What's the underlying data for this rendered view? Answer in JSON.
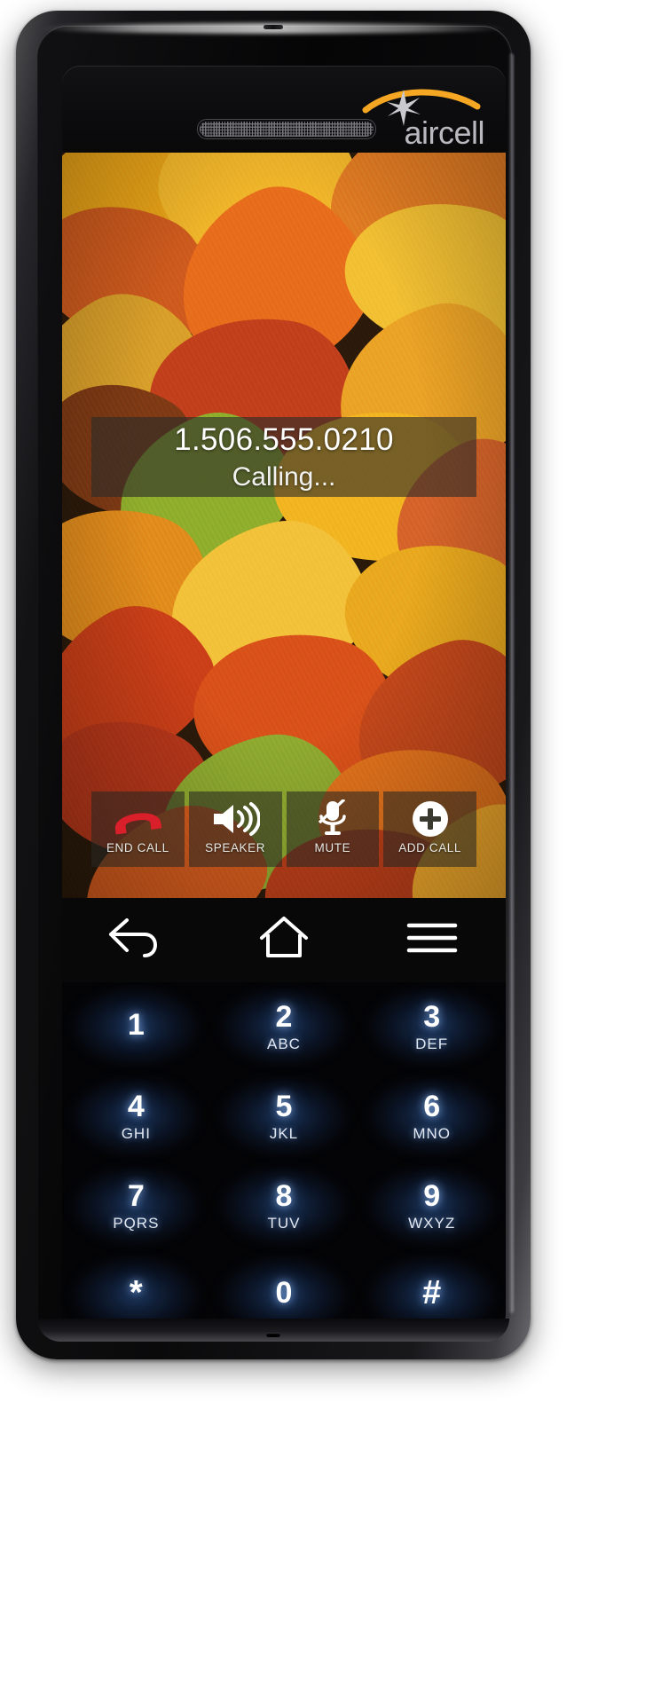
{
  "device": {
    "brand_name": "aircell",
    "brand_logo_icon": "aircell-swoosh-star-logo",
    "earpiece_icon": "earpiece-speaker-grille",
    "camera_icon": "front-camera",
    "mic_icon": "microphone-hole"
  },
  "screen": {
    "wallpaper_name": "autumn-leaves-wallpaper",
    "call": {
      "number": "1.506.555.0210",
      "status": "Calling...",
      "overlay_color": "#2c2c28"
    },
    "controls": [
      {
        "label": "END CALL",
        "icon": "end-call-handset-icon",
        "name": "end-call-button",
        "color": "#d81f2a"
      },
      {
        "label": "SPEAKER",
        "icon": "speaker-volume-icon",
        "name": "speaker-button",
        "color": "#ffffff"
      },
      {
        "label": "MUTE",
        "icon": "mute-microphone-slash-icon",
        "name": "mute-button",
        "color": "#ffffff"
      },
      {
        "label": "ADD CALL",
        "icon": "add-call-plus-circle-icon",
        "name": "add-call-button",
        "color": "#ffffff"
      }
    ]
  },
  "nav": [
    {
      "name": "back-button",
      "icon": "back-arrow-icon"
    },
    {
      "name": "home-button",
      "icon": "home-icon"
    },
    {
      "name": "menu-button",
      "icon": "menu-hamburger-icon"
    }
  ],
  "keypad": {
    "accent_glow": "#2e5ca2",
    "keys": [
      {
        "digit": "1",
        "letters": ""
      },
      {
        "digit": "2",
        "letters": "ABC"
      },
      {
        "digit": "3",
        "letters": "DEF"
      },
      {
        "digit": "4",
        "letters": "GHI"
      },
      {
        "digit": "5",
        "letters": "JKL"
      },
      {
        "digit": "6",
        "letters": "MNO"
      },
      {
        "digit": "7",
        "letters": "PQRS"
      },
      {
        "digit": "8",
        "letters": "TUV"
      },
      {
        "digit": "9",
        "letters": "WXYZ"
      },
      {
        "digit": "*",
        "letters": ""
      },
      {
        "digit": "0",
        "letters": ""
      },
      {
        "digit": "#",
        "letters": ""
      }
    ]
  }
}
